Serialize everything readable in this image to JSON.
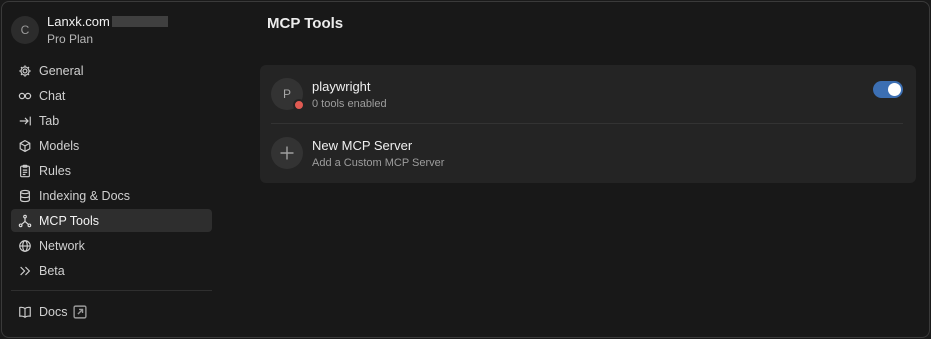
{
  "account": {
    "avatar_letter": "C",
    "email": "Lanxk.com",
    "plan": "Pro Plan"
  },
  "sidebar": {
    "items": [
      {
        "label": "General",
        "icon": "gear-icon"
      },
      {
        "label": "Chat",
        "icon": "infinity-icon"
      },
      {
        "label": "Tab",
        "icon": "arrow-right-bar-icon"
      },
      {
        "label": "Models",
        "icon": "cube-icon"
      },
      {
        "label": "Rules",
        "icon": "clipboard-icon"
      },
      {
        "label": "Indexing & Docs",
        "icon": "database-icon"
      },
      {
        "label": "MCP Tools",
        "icon": "fork-icon",
        "active": true
      },
      {
        "label": "Network",
        "icon": "globe-icon"
      },
      {
        "label": "Beta",
        "icon": "double-chevron-right-icon"
      }
    ],
    "docs": {
      "label": "Docs",
      "icon": "book-icon"
    }
  },
  "main": {
    "title": "MCP Tools",
    "servers": [
      {
        "avatar_letter": "P",
        "name": "playwright",
        "status": "0 tools enabled",
        "enabled": true,
        "status_color": "#e05a52"
      }
    ],
    "new_server": {
      "title": "New MCP Server",
      "subtitle": "Add a Custom MCP Server"
    }
  },
  "colors": {
    "accent": "#3c6fb3",
    "error": "#e05a52"
  }
}
